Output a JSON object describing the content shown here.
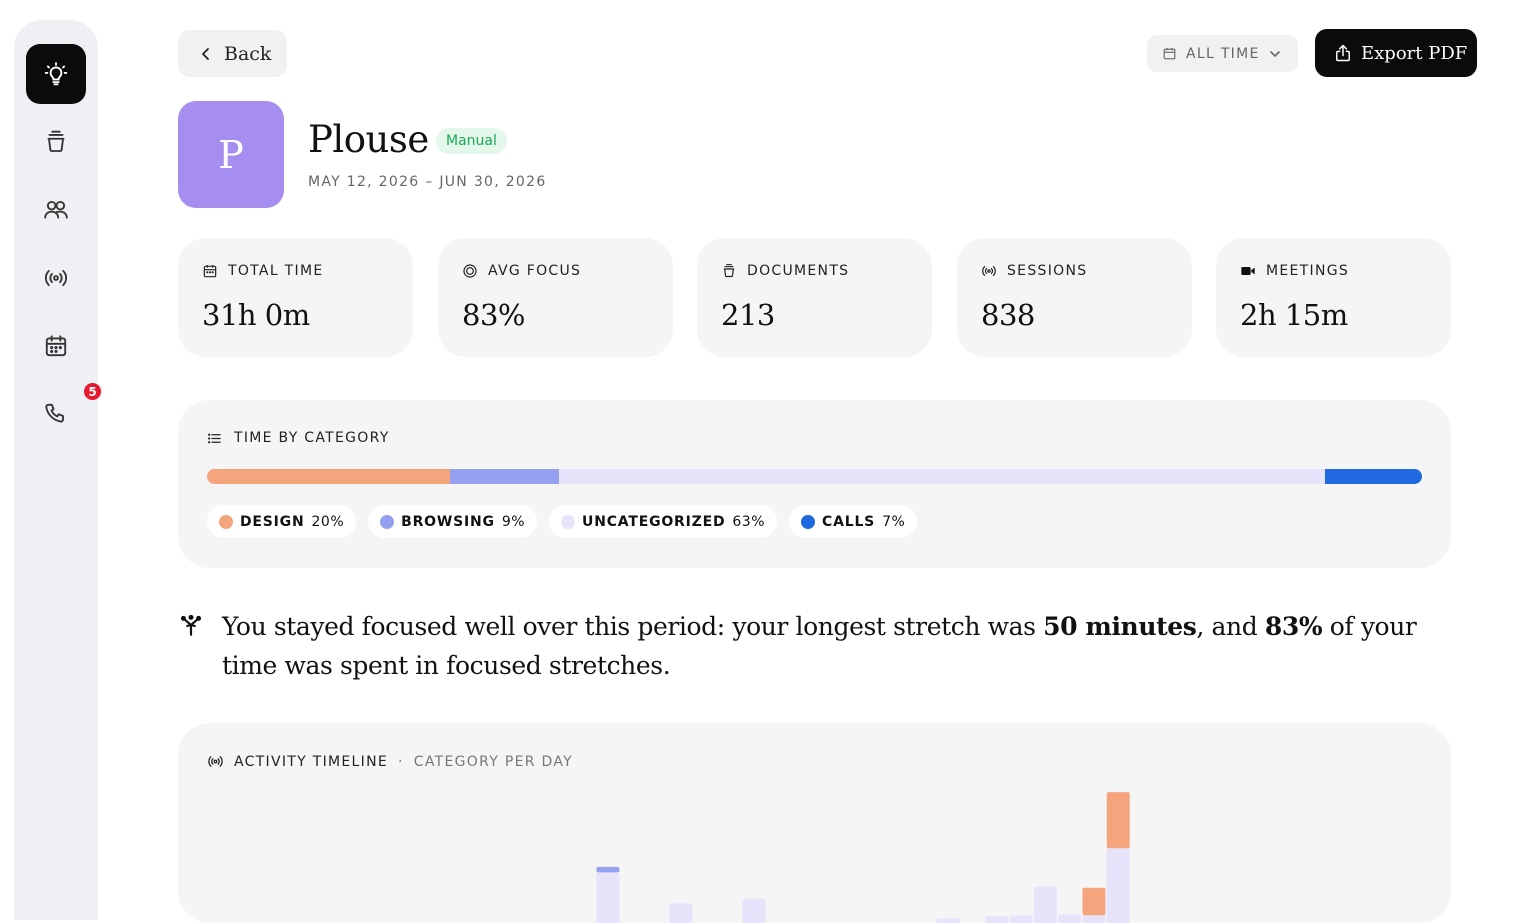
{
  "nav": {
    "items": [
      {
        "name": "insights",
        "icon": "lightbulb-icon",
        "active": true
      },
      {
        "name": "documents",
        "icon": "stack-icon"
      },
      {
        "name": "people",
        "icon": "users-icon"
      },
      {
        "name": "sessions",
        "icon": "broadcast-icon"
      },
      {
        "name": "calendar",
        "icon": "calendar-icon"
      },
      {
        "name": "calls",
        "icon": "phone-icon",
        "badge": "5"
      }
    ]
  },
  "toolbar": {
    "back_label": "Back",
    "period_label": "ALL TIME",
    "export_label": "Export PDF"
  },
  "project": {
    "initial": "P",
    "name": "Plouse",
    "tag": "Manual",
    "date_range": "MAY 12, 2026 – JUN 30, 2026",
    "avatar_color": "#a58ef0"
  },
  "stats": [
    {
      "label": "TOTAL TIME",
      "value": "31h 0m",
      "icon": "calendar-icon"
    },
    {
      "label": "AVG FOCUS",
      "value": "83%",
      "icon": "target-icon"
    },
    {
      "label": "DOCUMENTS",
      "value": "213",
      "icon": "stack-icon"
    },
    {
      "label": "SESSIONS",
      "value": "838",
      "icon": "broadcast-icon"
    },
    {
      "label": "MEETINGS",
      "value": "2h 15m",
      "icon": "video-icon"
    }
  ],
  "categories": {
    "title": "TIME BY CATEGORY",
    "items": [
      {
        "name": "DESIGN",
        "pct": "20%",
        "share": 0.2,
        "color": "#f5a57e"
      },
      {
        "name": "BROWSING",
        "pct": "9%",
        "share": 0.09,
        "color": "#96a0f0"
      },
      {
        "name": "UNCATEGORIZED",
        "pct": "63%",
        "share": 0.63,
        "color": "#e6e3fb"
      },
      {
        "name": "CALLS",
        "pct": "7%",
        "share": 0.08,
        "color": "#2069e0"
      }
    ]
  },
  "insight": {
    "before": "You stayed focused well over this period: your longest stretch was ",
    "highlight1": "50 minutes",
    "middle": ", and ",
    "highlight2": "83%",
    "after": " of your time was spent in focused stretches."
  },
  "timeline": {
    "title": "ACTIVITY TIMELINE",
    "separator": "·",
    "subtitle": "CATEGORY PER DAY"
  },
  "chart_data": {
    "type": "bar",
    "stacked": true,
    "series": [
      {
        "color": "#e6e3fb",
        "values": [
          2.3,
          0.9,
          1.1,
          0.2,
          0.3,
          0.35,
          1.65,
          0.4,
          0.35,
          3.4
        ]
      },
      {
        "color": "#96a0f0",
        "values": [
          0.25,
          0,
          0,
          0,
          0,
          0,
          0,
          0,
          0,
          0
        ]
      },
      {
        "color": "#f5a57e",
        "values": [
          0,
          0,
          0,
          0,
          0,
          0,
          0,
          0,
          1.25,
          2.55
        ]
      }
    ],
    "day_index": [
      16,
      19,
      22,
      30,
      32,
      33,
      34,
      35,
      36,
      37
    ],
    "day_count": 50
  }
}
